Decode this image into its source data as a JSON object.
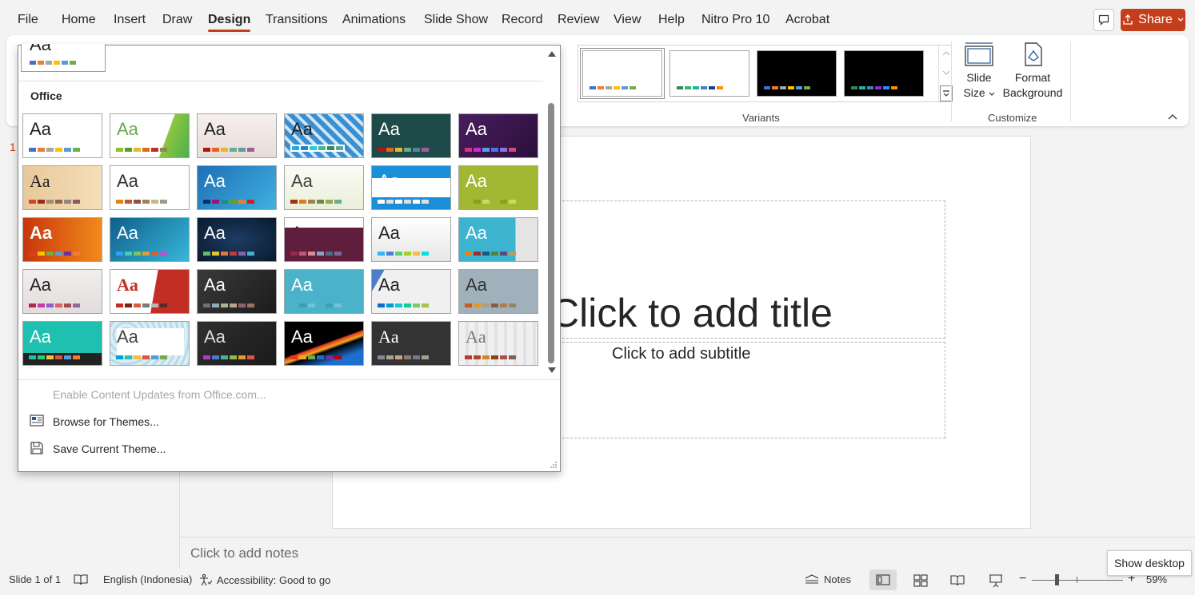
{
  "menu": {
    "items": [
      "File",
      "Home",
      "Insert",
      "Draw",
      "Design",
      "Transitions",
      "Animations",
      "Slide Show",
      "Record",
      "Review",
      "View",
      "Help",
      "Nitro Pro 10",
      "Acrobat"
    ],
    "active": "Design",
    "share_label": "Share"
  },
  "ribbon": {
    "variants_label": "Variants",
    "customize_label": "Customize",
    "slide_size_line1": "Slide",
    "slide_size_line2": "Size",
    "format_bg_line1": "Format",
    "format_bg_line2": "Background"
  },
  "themes_dropdown": {
    "top_thumb_text": "Aa",
    "section_label": "Office",
    "theme_text": "Aa",
    "enable_updates": "Enable Content Updates from Office.com...",
    "browse_themes": "Browse for Themes...",
    "save_theme": "Save Current Theme..."
  },
  "slide": {
    "panel_number": "1",
    "title_placeholder": "Click to add title",
    "subtitle_placeholder": "Click to add subtitle"
  },
  "notes": {
    "placeholder": "Click to add notes"
  },
  "status": {
    "slide_counter": "Slide 1 of 1",
    "language": "English (Indonesia)",
    "accessibility": "Accessibility: Good to go",
    "notes_label": "Notes",
    "zoom": "59%",
    "tooltip": "Show desktop"
  },
  "colors": {
    "accent": "#c43e1c",
    "ribbon_bg": "#ffffff",
    "app_bg": "#f3f3f3"
  }
}
